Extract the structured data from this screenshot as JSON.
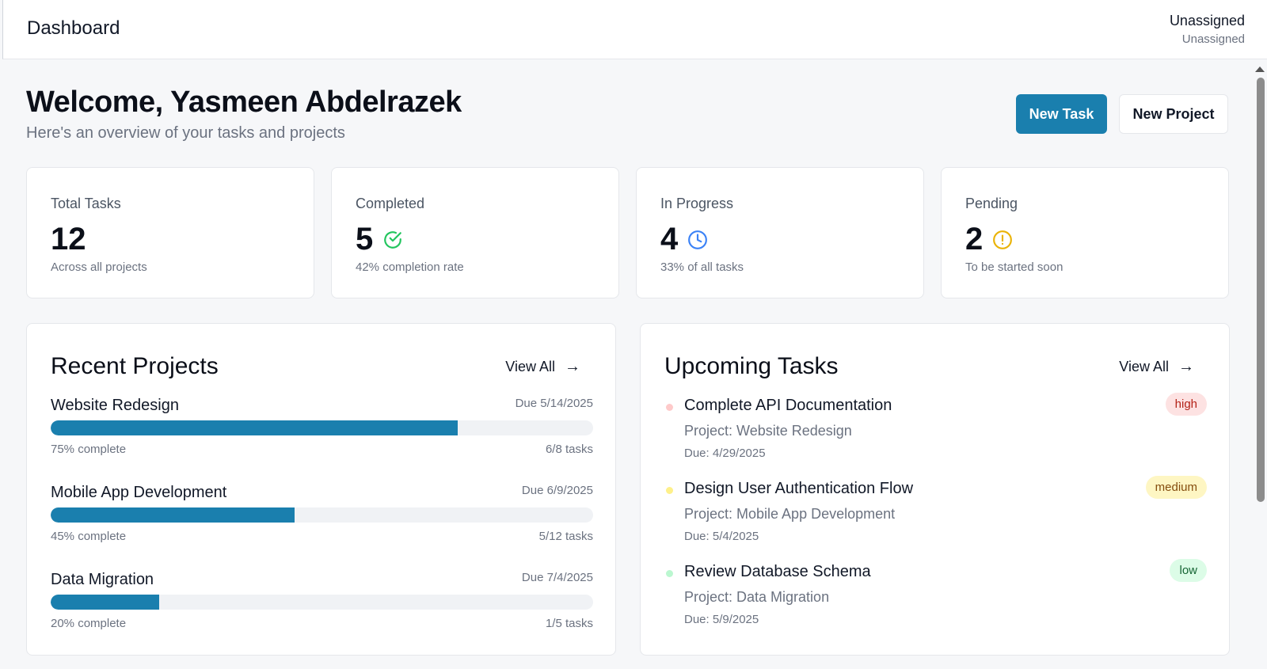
{
  "header": {
    "title": "Dashboard",
    "user_name": "Unassigned",
    "user_role": "Unassigned"
  },
  "welcome": {
    "heading": "Welcome, Yasmeen Abdelrazek",
    "subheading": "Here's an overview of your tasks and projects"
  },
  "actions": {
    "new_task": "New Task",
    "new_project": "New Project"
  },
  "stats": [
    {
      "label": "Total Tasks",
      "value": "12",
      "sub": "Across all projects",
      "icon": null
    },
    {
      "label": "Completed",
      "value": "5",
      "sub": "42% completion rate",
      "icon": "check-circle-icon",
      "icon_color": "#22c55e"
    },
    {
      "label": "In Progress",
      "value": "4",
      "sub": "33% of all tasks",
      "icon": "clock-icon",
      "icon_color": "#3b82f6"
    },
    {
      "label": "Pending",
      "value": "2",
      "sub": "To be started soon",
      "icon": "alert-circle-icon",
      "icon_color": "#eab308"
    }
  ],
  "recent_projects": {
    "title": "Recent Projects",
    "view_all": "View All",
    "items": [
      {
        "name": "Website Redesign",
        "due": "Due 5/14/2025",
        "progress": 75,
        "progress_label": "75% complete",
        "tasks": "6/8 tasks"
      },
      {
        "name": "Mobile App Development",
        "due": "Due 6/9/2025",
        "progress": 45,
        "progress_label": "45% complete",
        "tasks": "5/12 tasks"
      },
      {
        "name": "Data Migration",
        "due": "Due 7/4/2025",
        "progress": 20,
        "progress_label": "20% complete",
        "tasks": "1/5 tasks"
      }
    ]
  },
  "upcoming_tasks": {
    "title": "Upcoming Tasks",
    "view_all": "View All",
    "items": [
      {
        "name": "Complete API Documentation",
        "project": "Project: Website Redesign",
        "due": "Due: 4/29/2025",
        "priority": "high"
      },
      {
        "name": "Design User Authentication Flow",
        "project": "Project: Mobile App Development",
        "due": "Due: 5/4/2025",
        "priority": "medium"
      },
      {
        "name": "Review Database Schema",
        "project": "Project: Data Migration",
        "due": "Due: 5/9/2025",
        "priority": "low"
      }
    ]
  },
  "colors": {
    "accent": "#1a7fae",
    "high_bg": "#fde2e2",
    "high_text": "#b42318",
    "high_dot": "#fecaca",
    "medium_bg": "#fef6c3",
    "medium_text": "#854d0e",
    "medium_dot": "#fef08a",
    "low_bg": "#dcfce7",
    "low_text": "#166534",
    "low_dot": "#bbf7d0"
  }
}
